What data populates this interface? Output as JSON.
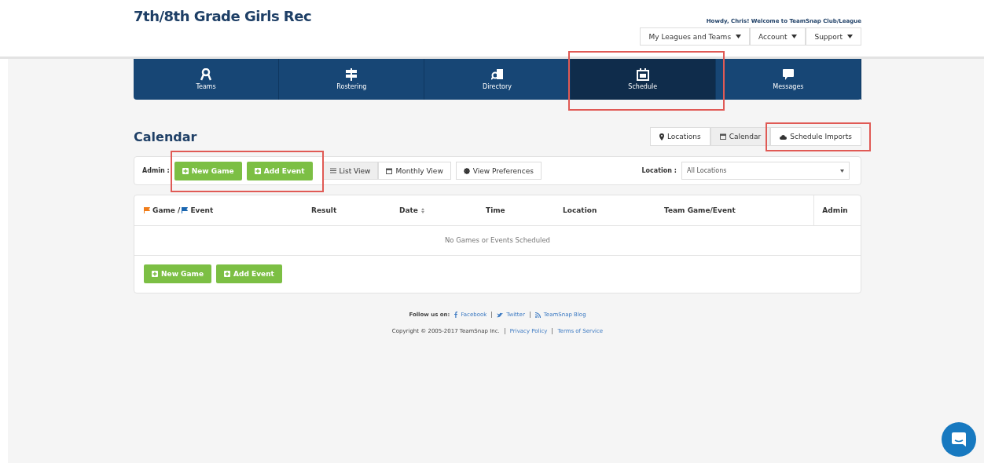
{
  "header": {
    "title": "7th/8th Grade Girls Rec",
    "greeting": "Howdy, Chris! Welcome to TeamSnap Club/League",
    "menus": [
      {
        "label": "My Leagues and Teams"
      },
      {
        "label": "Account"
      },
      {
        "label": "Support"
      }
    ]
  },
  "nav": [
    {
      "label": "Teams",
      "kind": "ribbon",
      "selected": false,
      "highlighted": false
    },
    {
      "label": "Rostering",
      "kind": "sign",
      "selected": false,
      "highlighted": false
    },
    {
      "label": "Directory",
      "kind": "book",
      "selected": false,
      "highlighted": false
    },
    {
      "label": "Schedule",
      "kind": "calendar",
      "selected": true,
      "highlighted": true
    },
    {
      "label": "Messages",
      "kind": "chat",
      "selected": false,
      "highlighted": false
    }
  ],
  "page_title": "Calendar",
  "views": [
    {
      "label": "Locations",
      "kind": "pin",
      "selected": false,
      "highlighted": false
    },
    {
      "label": "Calendar",
      "kind": "calendar",
      "selected": true,
      "highlighted": false
    },
    {
      "label": "Schedule Imports",
      "kind": "cloud",
      "selected": false,
      "highlighted": true
    }
  ],
  "toolbar": {
    "admin_label": "Admin :",
    "admin_highlighted": true,
    "admin_buttons": [
      {
        "label": "New Game"
      },
      {
        "label": "Add Event"
      }
    ],
    "view_modes": [
      {
        "label": "List View",
        "kind": "list",
        "selected": true
      },
      {
        "label": "Monthly View",
        "kind": "calendar",
        "selected": false
      }
    ],
    "preferences": "View Preferences",
    "location_label": "Location :",
    "location_value": "All Locations"
  },
  "table": {
    "columns": [
      {
        "label": "Game / ",
        "kind": "game"
      },
      {
        "label": "Result",
        "kind": "plain"
      },
      {
        "label": "Date",
        "kind": "sort"
      },
      {
        "label": "Time",
        "kind": "plain"
      },
      {
        "label": "Location",
        "kind": "plain"
      },
      {
        "label": "Team Game/Event",
        "kind": "plain"
      },
      {
        "label": "Admin",
        "kind": "admin"
      }
    ],
    "flag_second": "Event",
    "empty": "No Games or Events Scheduled",
    "buttons": [
      {
        "label": "New Game"
      },
      {
        "label": "Add Event"
      }
    ]
  },
  "footer": {
    "follow": "Follow us on:",
    "links": [
      {
        "label": "Facebook",
        "kind": "facebook"
      },
      {
        "label": "Twitter",
        "kind": "twitter"
      },
      {
        "label": "TeamSnap Blog",
        "kind": "rss"
      }
    ],
    "copyright": "Copyright © 2005-2017 TeamSnap Inc.",
    "legal": [
      {
        "label": "Privacy Policy"
      },
      {
        "label": "Terms of Service"
      }
    ]
  }
}
